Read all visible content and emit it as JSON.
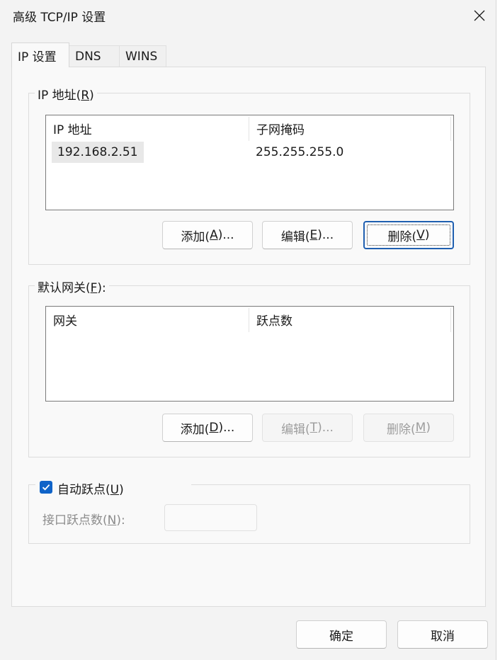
{
  "window": {
    "title": "高级 TCP/IP 设置"
  },
  "tabs": [
    {
      "label": "IP 设置"
    },
    {
      "label": "DNS"
    },
    {
      "label": "WINS"
    }
  ],
  "ip_group": {
    "legend_text": "IP 地址(",
    "legend_key": "R",
    "legend_end": ")",
    "columns": [
      "IP 地址",
      "子网掩码"
    ],
    "rows": [
      {
        "ip": "192.168.2.51",
        "mask": "255.255.255.0"
      }
    ],
    "buttons": {
      "add": {
        "pre": "添加(",
        "key": "A",
        "post": ")..."
      },
      "edit": {
        "pre": "编辑(",
        "key": "E",
        "post": ")..."
      },
      "delete": {
        "pre": "删除(",
        "key": "V",
        "post": ")"
      }
    }
  },
  "gateway_group": {
    "legend_text": "默认网关(",
    "legend_key": "F",
    "legend_end": "):",
    "columns": [
      "网关",
      "跃点数"
    ],
    "buttons": {
      "add": {
        "pre": "添加(",
        "key": "D",
        "post": ")..."
      },
      "edit": {
        "pre": "编辑(",
        "key": "T",
        "post": ")..."
      },
      "delete": {
        "pre": "删除(",
        "key": "M",
        "post": ")"
      }
    }
  },
  "metric_group": {
    "checkbox_text": "自动跃点(",
    "checkbox_key": "U",
    "checkbox_end": ")",
    "checked": true,
    "interface_label_text": "接口跃点数(",
    "interface_label_key": "N",
    "interface_label_end": "):",
    "interface_value": ""
  },
  "footer": {
    "ok": "确定",
    "cancel": "取消"
  },
  "colors": {
    "accent": "#0f63c8",
    "default_border": "#1f5fb0"
  },
  "icons": {
    "close": "close-icon",
    "check": "checkmark-icon"
  }
}
